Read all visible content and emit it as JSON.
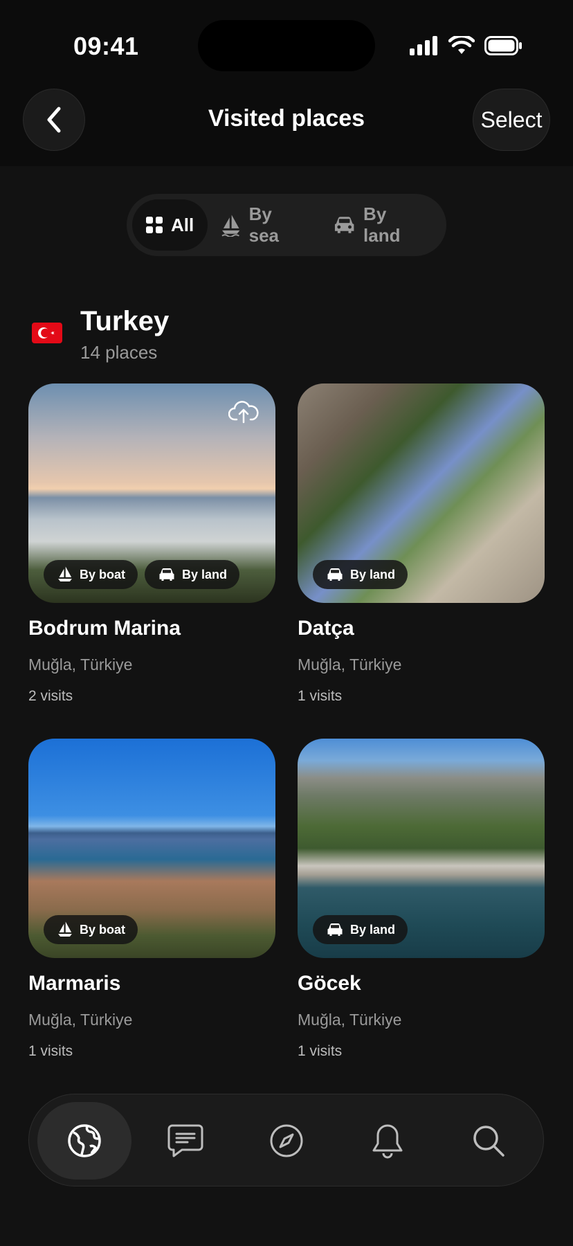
{
  "status_bar": {
    "time": "09:41"
  },
  "header": {
    "title": "Visited places",
    "select_label": "Select"
  },
  "filters": [
    {
      "label": "All",
      "icon": "grid-icon",
      "active": true
    },
    {
      "label": "By sea",
      "icon": "sailboat-icon",
      "active": false
    },
    {
      "label": "By land",
      "icon": "car-icon",
      "active": false
    }
  ],
  "section": {
    "country": "Turkey",
    "count": "14 places",
    "flag": "turkey-flag"
  },
  "places": [
    {
      "name": "Bodrum Marina",
      "location": "Muğla, Türkiye",
      "visits": "2 visits",
      "badges": [
        "By boat",
        "By land"
      ]
    },
    {
      "name": "Datça",
      "location": "Muğla, Türkiye",
      "visits": "1 visits",
      "badges": [
        "By land"
      ]
    },
    {
      "name": "Marmaris",
      "location": "Muğla, Türkiye",
      "visits": "1 visits",
      "badges": [
        "By boat"
      ]
    },
    {
      "name": "Göcek",
      "location": "Muğla, Türkiye",
      "visits": "1 visits",
      "badges": [
        "By land"
      ]
    }
  ],
  "tabbar": [
    "globe-icon",
    "chat-icon",
    "compass-icon",
    "bell-icon",
    "search-icon"
  ],
  "colors": {
    "background": "#121212",
    "header": "#0c0c0c",
    "surface": "#1b1b1b",
    "muted_text": "#9a9a9a",
    "flag_red": "#e30a17"
  }
}
